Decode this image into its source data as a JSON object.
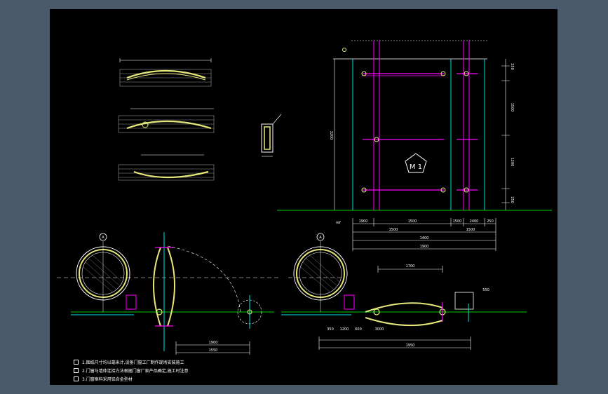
{
  "colors": {
    "canvas": "#000000",
    "frame": "#4a5a6a",
    "white": "#ffffff",
    "yellow": "#e8e87a",
    "cyan": "#00e5e5",
    "magenta": "#ff00ff",
    "green": "#00cc00",
    "grey": "#9a9a9a"
  },
  "labels": {
    "door_mark": "M 1",
    "axis_a": "A",
    "axis_b": "A"
  },
  "elevation_dims": {
    "right": [
      "250",
      "1500",
      "1200",
      "250"
    ],
    "left": "3200",
    "bottom_row1": [
      "1900",
      "1500",
      "1500",
      "2400",
      "250"
    ],
    "bottom_row2": [
      "1500",
      "1500"
    ],
    "bottom_row3": [
      "1400"
    ],
    "bottom_row4": [
      "1900"
    ]
  },
  "plan_dims": {
    "left_a": "1900",
    "left_b": "1550",
    "right_top": "1700",
    "right_mid": [
      "350",
      "1200",
      "600",
      "3000"
    ],
    "right_bot": "1950",
    "small": "550"
  },
  "notes": [
    "1.图纸尺寸均以毫米计,设备门窗工厂制作现场安装施工",
    "2.门窗与墙体连接方法根据门窗厂家产品确定,施工时注意",
    "3.门窗框料采用铝合金型材"
  ]
}
